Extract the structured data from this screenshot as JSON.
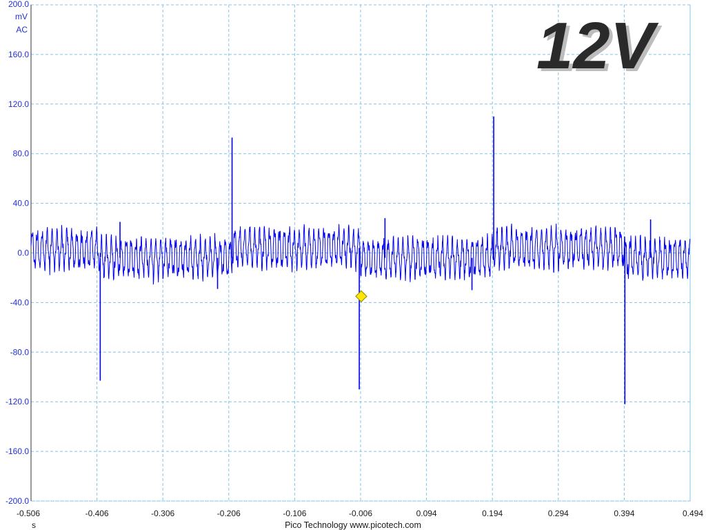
{
  "chart_data": {
    "type": "line",
    "title": "",
    "overlay_label": "12V",
    "y_unit": "mV",
    "coupling": "AC",
    "x_unit": "s",
    "xlim": [
      -0.506,
      0.494
    ],
    "ylim": [
      -200,
      200
    ],
    "x_ticks": [
      "-0.506",
      "-0.406",
      "-0.306",
      "-0.206",
      "-0.106",
      "-0.006",
      "0.094",
      "0.194",
      "0.294",
      "0.394",
      "0.494"
    ],
    "y_ticks": [
      "200.0",
      "160.0",
      "120.0",
      "80.0",
      "40.0",
      "0.0",
      "-40.0",
      "-80.0",
      "-120.0",
      "-160.0",
      "-200.0"
    ],
    "grid": true,
    "footer": "Pico Technology  www.picotech.com",
    "trigger": {
      "x": -0.005,
      "y": -35
    },
    "colors": {
      "trace": "#0000ee",
      "grid": "#80c4e8",
      "axis_text": "#1f2fd6",
      "trigger": "#ffe600",
      "badge": "#2a2a2a"
    },
    "series": [
      {
        "ripple": {
          "amplitude": 13,
          "period": 0.0075
        },
        "segments": [
          {
            "x0": -0.506,
            "x1": -0.402,
            "offset": 3
          },
          {
            "x0": -0.402,
            "x1": -0.201,
            "offset": -4
          },
          {
            "x0": -0.201,
            "x1": -0.006,
            "offset": 4
          },
          {
            "x0": -0.006,
            "x1": 0.196,
            "offset": -4
          },
          {
            "x0": 0.196,
            "x1": 0.395,
            "offset": 4
          },
          {
            "x0": 0.395,
            "x1": 0.494,
            "offset": -4
          }
        ],
        "spikes": [
          {
            "x": -0.401,
            "y": -103
          },
          {
            "x": -0.371,
            "y": 25
          },
          {
            "x": -0.223,
            "y": -29
          },
          {
            "x": -0.201,
            "y": 93
          },
          {
            "x": -0.008,
            "y": -110
          },
          {
            "x": 0.031,
            "y": 28
          },
          {
            "x": 0.163,
            "y": -30
          },
          {
            "x": 0.196,
            "y": 110
          },
          {
            "x": 0.395,
            "y": -122
          },
          {
            "x": 0.434,
            "y": 27
          }
        ]
      }
    ]
  }
}
